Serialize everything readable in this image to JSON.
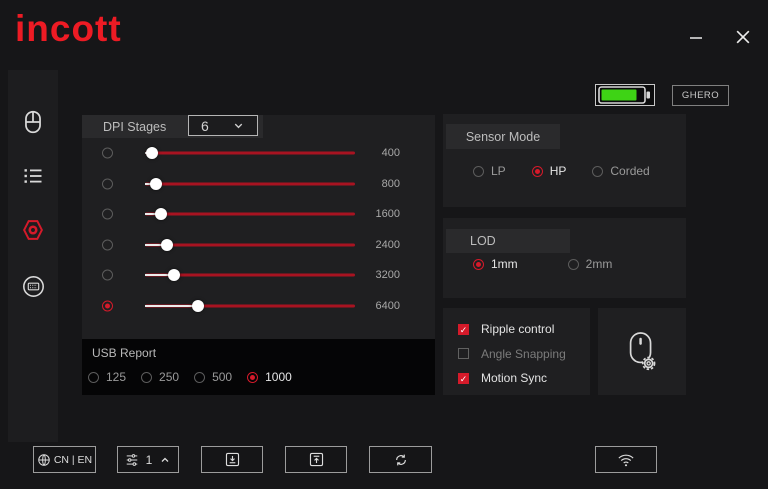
{
  "window": {
    "logo": "incott"
  },
  "status": {
    "battery_level": 85,
    "device_name": "GHERO"
  },
  "sidebar": {
    "active_index": 2,
    "items": [
      {
        "icon": "mouse-icon"
      },
      {
        "icon": "list-icon"
      },
      {
        "icon": "settings-hexagon-icon"
      },
      {
        "icon": "keyboard-icon"
      }
    ]
  },
  "dpi": {
    "title": "DPI Stages",
    "stage_count": "6",
    "stages": [
      {
        "value": "400",
        "percent": 3.2,
        "selected": false
      },
      {
        "value": "800",
        "percent": 5.0,
        "selected": false
      },
      {
        "value": "1600",
        "percent": 7.6,
        "selected": false
      },
      {
        "value": "2400",
        "percent": 10.6,
        "selected": false
      },
      {
        "value": "3200",
        "percent": 13.8,
        "selected": false
      },
      {
        "value": "6400",
        "percent": 25.4,
        "selected": true
      }
    ]
  },
  "usb_report": {
    "title": "USB Report",
    "options": [
      {
        "label": "125",
        "selected": false
      },
      {
        "label": "250",
        "selected": false
      },
      {
        "label": "500",
        "selected": false
      },
      {
        "label": "1000",
        "selected": true
      }
    ]
  },
  "sensor_mode": {
    "title": "Sensor Mode",
    "options": [
      {
        "label": "LP",
        "selected": false
      },
      {
        "label": "HP",
        "selected": true
      },
      {
        "label": "Corded",
        "selected": false
      }
    ]
  },
  "lod": {
    "title": "LOD",
    "options": [
      {
        "label": "1mm",
        "selected": true
      },
      {
        "label": "2mm",
        "selected": false
      }
    ]
  },
  "motion_options": [
    {
      "label": "Ripple control",
      "checked": true
    },
    {
      "label": "Angle Snapping",
      "checked": false
    },
    {
      "label": "Motion Sync",
      "checked": true
    }
  ],
  "footer": {
    "language_label": "CN | EN",
    "profile_number": "1"
  },
  "colors": {
    "accent": "#d51a2a",
    "logo_red": "#ed1b24",
    "slider_red": "#a81321",
    "battery_green": "#3ed315"
  }
}
